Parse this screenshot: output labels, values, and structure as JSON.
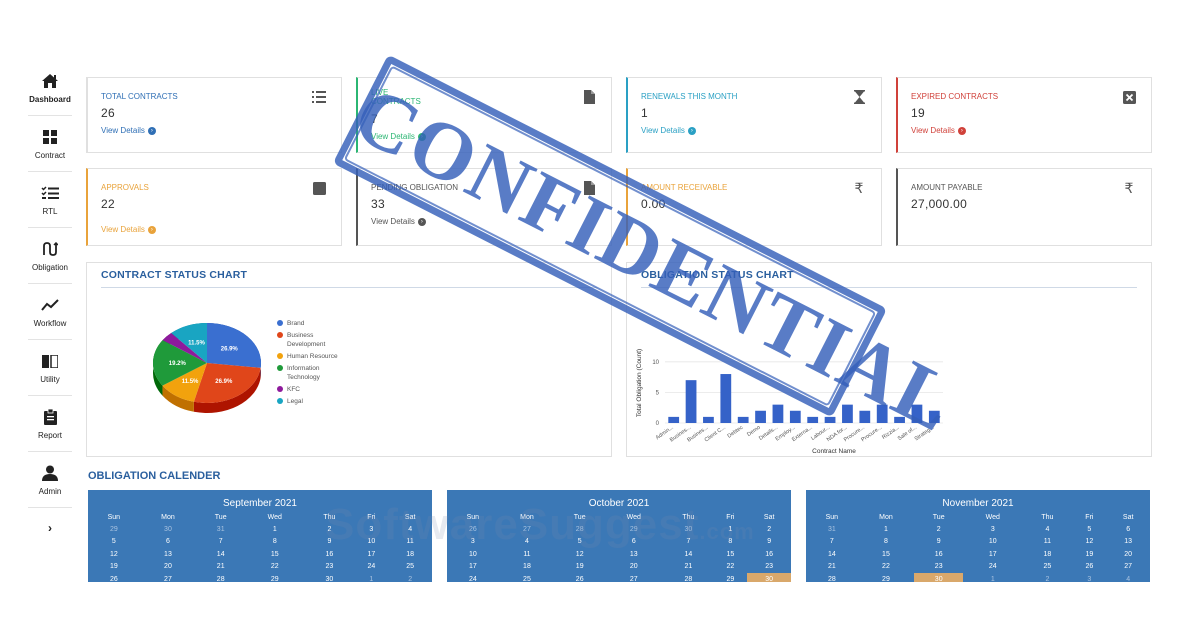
{
  "sidebar": {
    "items": [
      {
        "label": "Dashboard",
        "icon": "home-icon"
      },
      {
        "label": "Contract",
        "icon": "grid-icon"
      },
      {
        "label": "RTL",
        "icon": "checklist-icon"
      },
      {
        "label": "Obligation",
        "icon": "obligation-icon"
      },
      {
        "label": "Workflow",
        "icon": "trend-icon"
      },
      {
        "label": "Utility",
        "icon": "book-icon"
      },
      {
        "label": "Report",
        "icon": "clipboard-icon"
      },
      {
        "label": "Admin",
        "icon": "user-icon"
      }
    ],
    "expand": "›"
  },
  "cards": {
    "total_contracts": {
      "title": "TOTAL CONTRACTS",
      "value": "26",
      "link": "View Details",
      "color": "#2f6fb5",
      "icon": "list-icon"
    },
    "live_contracts": {
      "title_line1": "LIVE",
      "title_line2": "CONTRACTS",
      "value": "7",
      "link": "View Details",
      "color": "#2bb673",
      "icon": "file-icon"
    },
    "renewals": {
      "title": "RENEWALS THIS MONTH",
      "value": "1",
      "link": "View Details",
      "color": "#2aa0c4",
      "icon": "hourglass-icon"
    },
    "expired": {
      "title": "EXPIRED CONTRACTS",
      "value": "19",
      "link": "View Details",
      "color": "#d0413a",
      "icon": "close-box-icon"
    },
    "approvals": {
      "title": "APPROVALS",
      "value": "22",
      "link": "View Details",
      "color": "#e9a33b",
      "icon": "stamp-icon"
    },
    "pending_obligation": {
      "title": "PENDING OBLIGATION",
      "value": "33",
      "link": "View Details",
      "color": "#555555",
      "icon": "file-icon"
    },
    "amount_receivable": {
      "title": "AMOUNT RECEIVABLE",
      "value": "0.00",
      "color": "#e9a33b",
      "icon": "rupee-icon",
      "symbol": "₹"
    },
    "amount_payable": {
      "title": "AMOUNT PAYABLE",
      "value": "27,000.00",
      "color": "#555555",
      "icon": "rupee-icon",
      "symbol": "₹"
    }
  },
  "contract_chart": {
    "title": "CONTRACT STATUS CHART",
    "legend": [
      {
        "label": "Brand",
        "color": "#3a6fd0"
      },
      {
        "label": "Business Development",
        "color": "#e0461a"
      },
      {
        "label": "Human Resource",
        "color": "#f2a20d"
      },
      {
        "label": "Information Technology",
        "color": "#1f9a3a"
      },
      {
        "label": "KFC",
        "color": "#8e1a9c"
      },
      {
        "label": "Legal",
        "color": "#19a5c2"
      }
    ]
  },
  "obligation_chart": {
    "title": "OBLIGATION STATUS CHART",
    "xlabel": "Contract Name",
    "ylabel": "Total Obligation (Count)",
    "bar_color": "#3562c8"
  },
  "chart_data": [
    {
      "type": "pie",
      "categories": [
        "Brand",
        "Business Development",
        "Human Resource",
        "Information Technology",
        "KFC",
        "Legal"
      ],
      "values": [
        26.9,
        26.9,
        11.5,
        19.2,
        3.8,
        11.5
      ],
      "labels": [
        "26.9%",
        "26.9%",
        "11.5%",
        "19.2%",
        "",
        "11.5%"
      ],
      "colors": [
        "#3a6fd0",
        "#e0461a",
        "#f2a20d",
        "#1f9a3a",
        "#8e1a9c",
        "#19a5c2"
      ]
    },
    {
      "type": "bar",
      "categories": [
        "Admin...",
        "Busines...",
        "Busines...",
        "Client C...",
        "Debtec",
        "Demo",
        "Details...",
        "Employ...",
        "Externa...",
        "Labour...",
        "NDA for...",
        "Procure...",
        "Procure...",
        "Rizzia...",
        "Sale of...",
        "Strateg..."
      ],
      "values": [
        1,
        7,
        1,
        8,
        1,
        2,
        3,
        2,
        1,
        1,
        3,
        2,
        3,
        1,
        3,
        2
      ],
      "ylim": [
        0,
        10
      ],
      "yticks": [
        "0",
        "5",
        "10"
      ],
      "xlabel": "Contract Name",
      "ylabel": "Total Obligation (Count)"
    }
  ],
  "calendar": {
    "title": "OBLIGATION CALENDER",
    "weekdays": [
      "Sun",
      "Mon",
      "Tue",
      "Wed",
      "Thu",
      "Fri",
      "Sat"
    ],
    "months": [
      {
        "name": "September 2021",
        "rows": [
          [
            "29",
            "30",
            "31",
            "1",
            "2",
            "3",
            "4"
          ],
          [
            "5",
            "6",
            "7",
            "8",
            "9",
            "10",
            "11"
          ],
          [
            "12",
            "13",
            "14",
            "15",
            "16",
            "17",
            "18"
          ],
          [
            "19",
            "20",
            "21",
            "22",
            "23",
            "24",
            "25"
          ],
          [
            "26",
            "27",
            "28",
            "29",
            "30",
            "1",
            "2"
          ]
        ],
        "today": null
      },
      {
        "name": "October 2021",
        "rows": [
          [
            "26",
            "27",
            "28",
            "29",
            "30",
            "1",
            "2"
          ],
          [
            "3",
            "4",
            "5",
            "6",
            "7",
            "8",
            "9"
          ],
          [
            "10",
            "11",
            "12",
            "13",
            "14",
            "15",
            "16"
          ],
          [
            "17",
            "18",
            "19",
            "20",
            "21",
            "22",
            "23"
          ],
          [
            "24",
            "25",
            "26",
            "27",
            "28",
            "29",
            "30"
          ]
        ],
        "today": [
          4,
          6
        ]
      },
      {
        "name": "November 2021",
        "rows": [
          [
            "31",
            "1",
            "2",
            "3",
            "4",
            "5",
            "6"
          ],
          [
            "7",
            "8",
            "9",
            "10",
            "11",
            "12",
            "13"
          ],
          [
            "14",
            "15",
            "16",
            "17",
            "18",
            "19",
            "20"
          ],
          [
            "21",
            "22",
            "23",
            "24",
            "25",
            "26",
            "27"
          ],
          [
            "28",
            "29",
            "30",
            "1",
            "2",
            "3",
            "4"
          ]
        ],
        "today": [
          4,
          2
        ]
      }
    ]
  },
  "stamp": {
    "text": "CONFIDENTIAL"
  },
  "watermark": {
    "text": "SoftwareSuggest",
    "suffix": ".com"
  }
}
